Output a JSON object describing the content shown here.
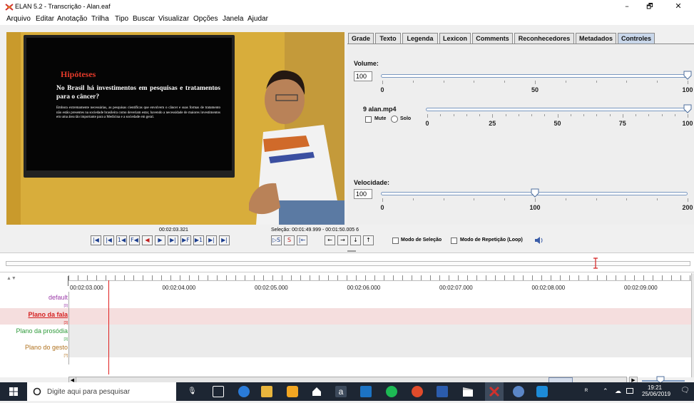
{
  "window": {
    "title": "ELAN 5.2 - Transcrição - Alan.eaf",
    "minimize": "–",
    "restore": "🗗",
    "close": "✕"
  },
  "menu": [
    "Arquivo",
    "Editar",
    "Anotação",
    "Trilha",
    "Tipo",
    "Buscar",
    "Visualizar",
    "Opções",
    "Janela",
    "Ajudar"
  ],
  "video": {
    "slide_title": "Hipóteses",
    "slide_heading": "No Brasil há investimentos em pesquisas e tratamentos para o câncer?",
    "slide_body": "Embora extremamente necessárias, as pesquisas científicas que envolvem o câncer e suas formas de tratamento não estão presentes na sociedade brasileira como deveriam estar, havendo a necessidade de maiores investimentos em uma área tão importante para a Medicina e a sociedade em geral."
  },
  "tabs": [
    {
      "label": "Grade",
      "active": false
    },
    {
      "label": "Texto",
      "active": false
    },
    {
      "label": "Legenda",
      "active": false
    },
    {
      "label": "Lexicon",
      "active": false
    },
    {
      "label": "Comments",
      "active": false
    },
    {
      "label": "Reconhecedores",
      "active": false
    },
    {
      "label": "Metadados",
      "active": false
    },
    {
      "label": "Controles",
      "active": true
    }
  ],
  "controls": {
    "volume_label": "Volume:",
    "volume_value": "100",
    "volume_ticks": [
      "0",
      "50",
      "100"
    ],
    "volume_level": 1.0,
    "media_label": "9 alan.mp4",
    "mute_label": "Mute",
    "solo_label": "Solo",
    "media_ticks": [
      "0",
      "25",
      "50",
      "75",
      "100"
    ],
    "media_level": 1.0,
    "speed_label": "Velocidade:",
    "speed_value": "100",
    "speed_ticks": [
      "0",
      "100",
      "200"
    ],
    "speed_level": 0.5
  },
  "player": {
    "current_time": "00:02:03.321",
    "selection": "Seleção: 00:01:49.999 - 00:01:50.005  6",
    "selection_mode_label": "Modo de Seleção",
    "loop_mode_label": "Modo de Repetição (Loop)",
    "buttons": [
      "|◀",
      "|◀",
      "1◀",
      "F◀",
      "◀",
      "▶",
      "▶|",
      "▶F",
      "▶1",
      "▶|",
      "▶|"
    ],
    "sel_buttons": [
      "▷S",
      "S",
      "|←"
    ],
    "nav_buttons": [
      "←",
      "→",
      "↓",
      "↑"
    ]
  },
  "timeline": {
    "time_labels": [
      "00:02:03.000",
      "00:02:04.000",
      "00:02:05.000",
      "00:02:06.000",
      "00:02:07.000",
      "00:02:08.000",
      "00:02:09.000"
    ],
    "tiers": [
      {
        "name": "default",
        "count": "[0]",
        "color": "#9b3aa8"
      },
      {
        "name": "Plano da fala",
        "count": "[3]",
        "color": "#d42020"
      },
      {
        "name": "Plano da prosódia",
        "count": "[3]",
        "color": "#2e9a3a"
      },
      {
        "name": "Plano do gesto",
        "count": "[?]",
        "color": "#b0721f"
      }
    ]
  },
  "taskbar": {
    "search_placeholder": "Digite aqui para pesquisar",
    "time": "19:21",
    "date": "25/06/2019"
  }
}
